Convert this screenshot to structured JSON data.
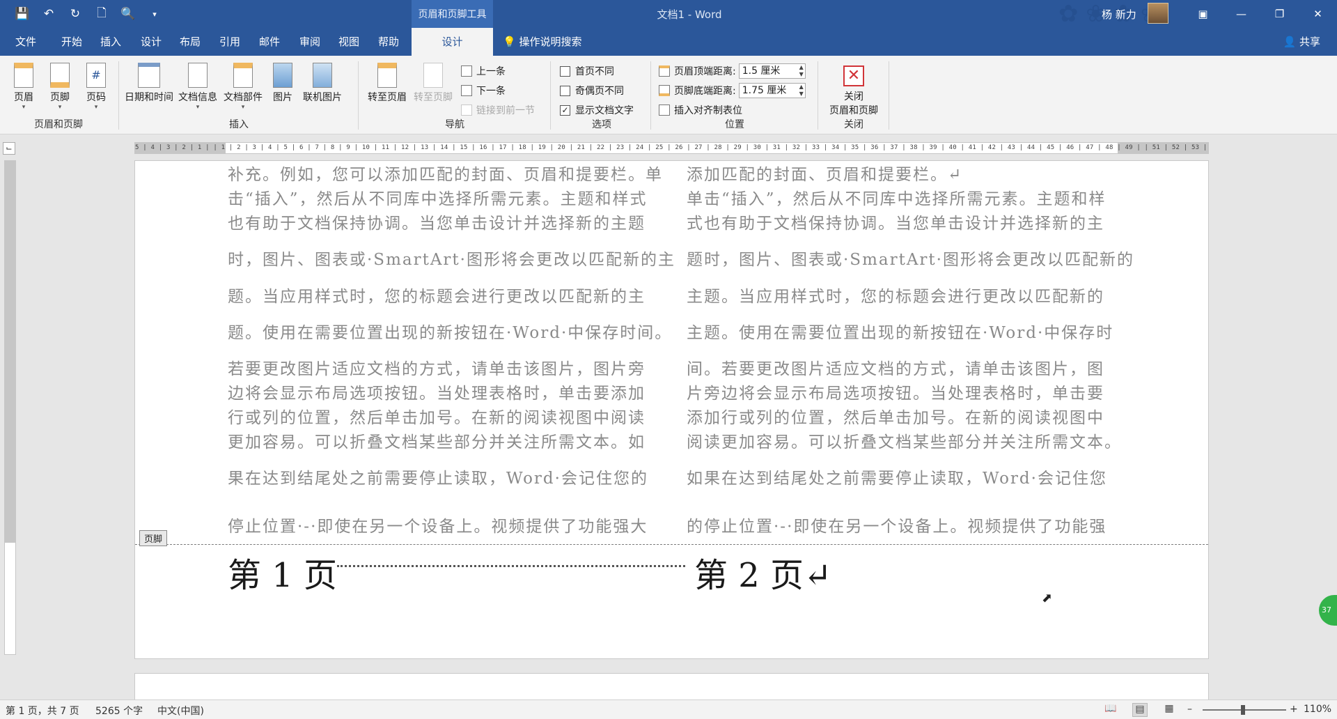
{
  "titlebar": {
    "context_tab_title": "页眉和页脚工具",
    "doc_title": "文档1  -  Word",
    "username": "杨 新力",
    "qat": [
      "save-icon",
      "undo-icon",
      "redo-icon",
      "new-doc-icon",
      "print-preview-icon",
      "customize-icon"
    ]
  },
  "menu": {
    "items": [
      "文件",
      "开始",
      "插入",
      "设计",
      "布局",
      "引用",
      "邮件",
      "审阅",
      "视图",
      "帮助"
    ],
    "active_tab": "设计",
    "tell_me": "操作说明搜索",
    "share": "共享"
  },
  "ribbon": {
    "groups": {
      "header_footer": {
        "label": "页眉和页脚",
        "buttons": [
          "页眉",
          "页脚",
          "页码"
        ]
      },
      "insert": {
        "label": "插入",
        "buttons": [
          "日期和时间",
          "文档信息",
          "文档部件",
          "图片",
          "联机图片"
        ]
      },
      "navigation": {
        "label": "导航",
        "goto_header": "转至页眉",
        "goto_footer": "转至页脚",
        "prev": "上一条",
        "next": "下一条",
        "link_prev": "链接到前一节"
      },
      "options": {
        "label": "选项",
        "first_page_diff": "首页不同",
        "odd_even_diff": "奇偶页不同",
        "show_doc_text": "显示文档文字",
        "show_doc_text_checked": true
      },
      "position": {
        "label": "位置",
        "header_top_label": "页眉顶端距离:",
        "header_top_value": "1.5 厘米",
        "footer_bottom_label": "页脚底端距离:",
        "footer_bottom_value": "1.75 厘米",
        "insert_align_tab": "插入对齐制表位"
      },
      "close": {
        "label": "关闭",
        "button_line1": "关闭",
        "button_line2": "页眉和页脚"
      }
    }
  },
  "ruler": {
    "h_ticks": "5 | 4 | 3 | 2 | 1 |   | 1 | 2 | 3 | 4 | 5 | 6 | 7 | 8 | 9 | 10 | 11 | 12 | 13 | 14 | 15 | 16 | 17 | 18 | 19 | 20 | 21 | 22 | 23 | 24 | 25 | 26 | 27 | 28 | 29 | 30 | 31 | 32 | 33 | 34 | 35 | 36 | 37 | 38 | 39 | 40 | 41 | 42 | 43 | 44 | 45 | 46 | 47 | 48 | 49 |   | 51 | 52 | 53 | 54 |"
  },
  "document": {
    "col1": [
      "补充。例如，您可以添加匹配的封面、页眉和提要栏。单",
      "击“插入”，然后从不同库中选择所需元素。主题和样式",
      "也有助于文档保持协调。当您单击设计并选择新的主题",
      "时，图片、图表或·SmartArt·图形将会更改以匹配新的主",
      "题。当应用样式时，您的标题会进行更改以匹配新的主",
      "题。使用在需要位置出现的新按钮在·Word·中保存时间。",
      "若要更改图片适应文档的方式，请单击该图片，图片旁",
      "边将会显示布局选项按钮。当处理表格时，单击要添加",
      "行或列的位置，然后单击加号。在新的阅读视图中阅读",
      "更加容易。可以折叠文档某些部分并关注所需文本。如",
      "果在达到结尾处之前需要停止读取，Word·会记住您的",
      "停止位置·-·即使在另一个设备上。视频提供了功能强大"
    ],
    "col2": [
      "添加匹配的封面、页眉和提要栏。↵",
      "单击“插入”，然后从不同库中选择所需元素。主题和样",
      "式也有助于文档保持协调。当您单击设计并选择新的主",
      "题时，图片、图表或·SmartArt·图形将会更改以匹配新的",
      "主题。当应用样式时，您的标题会进行更改以匹配新的",
      "主题。使用在需要位置出现的新按钮在·Word·中保存时",
      "间。若要更改图片适应文档的方式，请单击该图片，图",
      "片旁边将会显示布局选项按钮。当处理表格时，单击要",
      "添加行或列的位置，然后单击加号。在新的阅读视图中",
      "阅读更加容易。可以折叠文档某些部分并关注所需文本。",
      "如果在达到结尾处之前需要停止读取，Word·会记住您",
      "的停止位置·-·即使在另一个设备上。视频提供了功能强"
    ],
    "footer_tag": "页脚",
    "footer_left": "第 1 页",
    "footer_right": "第 2 页↵",
    "bubble": "37"
  },
  "status": {
    "page": "第 1 页，共 7 页",
    "words": "5265 个字",
    "lang": "中文(中国)",
    "zoom": "110%"
  },
  "colors": {
    "brand": "#2b579a",
    "close_red": "#d13438"
  }
}
